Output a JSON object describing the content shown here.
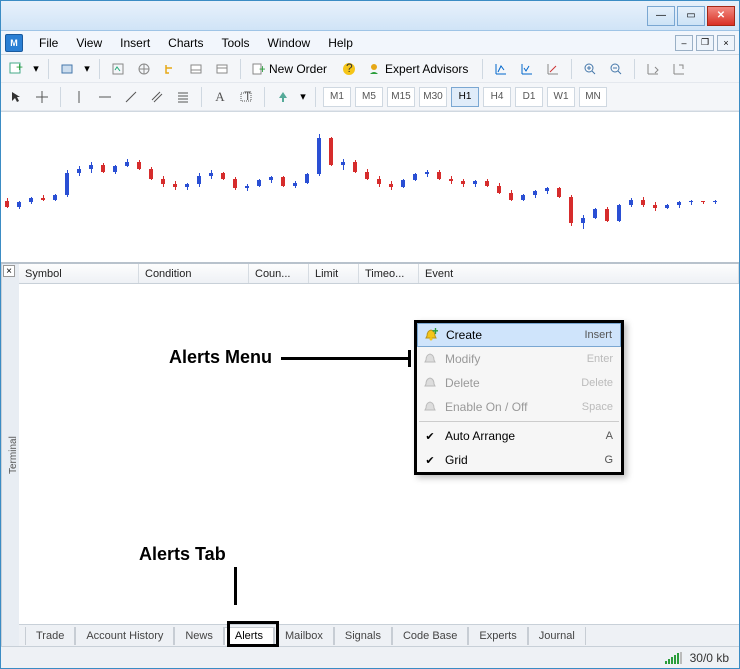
{
  "window": {
    "title": ""
  },
  "menubar": {
    "items": [
      "File",
      "View",
      "Insert",
      "Charts",
      "Tools",
      "Window",
      "Help"
    ]
  },
  "toolbar1": {
    "new_order": "New Order",
    "expert_advisors": "Expert Advisors"
  },
  "timeframes": [
    "M1",
    "M5",
    "M15",
    "M30",
    "H1",
    "H4",
    "D1",
    "W1",
    "MN"
  ],
  "active_timeframe": "H1",
  "terminal": {
    "label": "Terminal",
    "columns": {
      "symbol": "Symbol",
      "condition": "Condition",
      "counter": "Coun...",
      "limit": "Limit",
      "timeout": "Timeo...",
      "event": "Event"
    }
  },
  "context_menu": {
    "create": {
      "label": "Create",
      "shortcut": "Insert"
    },
    "modify": {
      "label": "Modify",
      "shortcut": "Enter"
    },
    "delete": {
      "label": "Delete",
      "shortcut": "Delete"
    },
    "enable": {
      "label": "Enable On / Off",
      "shortcut": "Space"
    },
    "auto_arrange": {
      "label": "Auto Arrange",
      "shortcut": "A"
    },
    "grid": {
      "label": "Grid",
      "shortcut": "G"
    }
  },
  "tabs": [
    "Trade",
    "Account History",
    "News",
    "Alerts",
    "Mailbox",
    "Signals",
    "Code Base",
    "Experts",
    "Journal"
  ],
  "active_tab": "Alerts",
  "status": {
    "traffic": "30/0 kb"
  },
  "annotations": {
    "menu_label": "Alerts Menu",
    "tab_label": "Alerts Tab"
  },
  "chart_data": {
    "type": "candlestick",
    "note": "Forex candlestick chart, approximate OHLC inferred from relative heights (arbitrary units 0-100, higher = higher price)",
    "series": [
      {
        "o": 40,
        "h": 42,
        "l": 35,
        "c": 36,
        "color": "red"
      },
      {
        "o": 36,
        "h": 40,
        "l": 34,
        "c": 39,
        "color": "blue"
      },
      {
        "o": 39,
        "h": 43,
        "l": 38,
        "c": 42,
        "color": "blue"
      },
      {
        "o": 42,
        "h": 44,
        "l": 40,
        "c": 41,
        "color": "red"
      },
      {
        "o": 41,
        "h": 45,
        "l": 40,
        "c": 44,
        "color": "blue"
      },
      {
        "o": 44,
        "h": 62,
        "l": 43,
        "c": 60,
        "color": "blue"
      },
      {
        "o": 60,
        "h": 65,
        "l": 58,
        "c": 63,
        "color": "blue"
      },
      {
        "o": 63,
        "h": 68,
        "l": 60,
        "c": 66,
        "color": "blue"
      },
      {
        "o": 66,
        "h": 67,
        "l": 60,
        "c": 61,
        "color": "red"
      },
      {
        "o": 61,
        "h": 66,
        "l": 59,
        "c": 65,
        "color": "blue"
      },
      {
        "o": 65,
        "h": 70,
        "l": 64,
        "c": 68,
        "color": "blue"
      },
      {
        "o": 68,
        "h": 69,
        "l": 62,
        "c": 63,
        "color": "red"
      },
      {
        "o": 63,
        "h": 64,
        "l": 55,
        "c": 56,
        "color": "red"
      },
      {
        "o": 56,
        "h": 58,
        "l": 50,
        "c": 52,
        "color": "red"
      },
      {
        "o": 52,
        "h": 54,
        "l": 48,
        "c": 50,
        "color": "red"
      },
      {
        "o": 50,
        "h": 53,
        "l": 48,
        "c": 52,
        "color": "blue"
      },
      {
        "o": 52,
        "h": 60,
        "l": 50,
        "c": 58,
        "color": "blue"
      },
      {
        "o": 58,
        "h": 62,
        "l": 56,
        "c": 60,
        "color": "blue"
      },
      {
        "o": 60,
        "h": 61,
        "l": 55,
        "c": 56,
        "color": "red"
      },
      {
        "o": 56,
        "h": 57,
        "l": 48,
        "c": 49,
        "color": "red"
      },
      {
        "o": 49,
        "h": 52,
        "l": 47,
        "c": 51,
        "color": "blue"
      },
      {
        "o": 51,
        "h": 56,
        "l": 50,
        "c": 55,
        "color": "blue"
      },
      {
        "o": 55,
        "h": 58,
        "l": 53,
        "c": 57,
        "color": "blue"
      },
      {
        "o": 57,
        "h": 58,
        "l": 50,
        "c": 51,
        "color": "red"
      },
      {
        "o": 51,
        "h": 54,
        "l": 49,
        "c": 53,
        "color": "blue"
      },
      {
        "o": 53,
        "h": 60,
        "l": 52,
        "c": 59,
        "color": "blue"
      },
      {
        "o": 59,
        "h": 88,
        "l": 58,
        "c": 85,
        "color": "blue"
      },
      {
        "o": 85,
        "h": 86,
        "l": 65,
        "c": 66,
        "color": "red"
      },
      {
        "o": 66,
        "h": 70,
        "l": 62,
        "c": 68,
        "color": "blue"
      },
      {
        "o": 68,
        "h": 69,
        "l": 60,
        "c": 61,
        "color": "red"
      },
      {
        "o": 61,
        "h": 63,
        "l": 55,
        "c": 56,
        "color": "red"
      },
      {
        "o": 56,
        "h": 58,
        "l": 50,
        "c": 52,
        "color": "red"
      },
      {
        "o": 52,
        "h": 54,
        "l": 48,
        "c": 50,
        "color": "red"
      },
      {
        "o": 50,
        "h": 56,
        "l": 49,
        "c": 55,
        "color": "blue"
      },
      {
        "o": 55,
        "h": 60,
        "l": 54,
        "c": 59,
        "color": "blue"
      },
      {
        "o": 59,
        "h": 62,
        "l": 57,
        "c": 61,
        "color": "blue"
      },
      {
        "o": 61,
        "h": 62,
        "l": 55,
        "c": 56,
        "color": "red"
      },
      {
        "o": 56,
        "h": 58,
        "l": 52,
        "c": 54,
        "color": "red"
      },
      {
        "o": 54,
        "h": 56,
        "l": 50,
        "c": 52,
        "color": "red"
      },
      {
        "o": 52,
        "h": 55,
        "l": 50,
        "c": 54,
        "color": "blue"
      },
      {
        "o": 54,
        "h": 56,
        "l": 50,
        "c": 51,
        "color": "red"
      },
      {
        "o": 51,
        "h": 53,
        "l": 45,
        "c": 46,
        "color": "red"
      },
      {
        "o": 46,
        "h": 48,
        "l": 40,
        "c": 41,
        "color": "red"
      },
      {
        "o": 41,
        "h": 45,
        "l": 40,
        "c": 44,
        "color": "blue"
      },
      {
        "o": 44,
        "h": 48,
        "l": 42,
        "c": 47,
        "color": "blue"
      },
      {
        "o": 47,
        "h": 50,
        "l": 45,
        "c": 49,
        "color": "blue"
      },
      {
        "o": 49,
        "h": 50,
        "l": 42,
        "c": 43,
        "color": "red"
      },
      {
        "o": 43,
        "h": 44,
        "l": 22,
        "c": 24,
        "color": "red"
      },
      {
        "o": 24,
        "h": 30,
        "l": 20,
        "c": 28,
        "color": "blue"
      },
      {
        "o": 28,
        "h": 35,
        "l": 27,
        "c": 34,
        "color": "blue"
      },
      {
        "o": 34,
        "h": 36,
        "l": 25,
        "c": 26,
        "color": "red"
      },
      {
        "o": 26,
        "h": 38,
        "l": 25,
        "c": 37,
        "color": "blue"
      },
      {
        "o": 37,
        "h": 42,
        "l": 36,
        "c": 41,
        "color": "blue"
      },
      {
        "o": 41,
        "h": 43,
        "l": 36,
        "c": 37,
        "color": "red"
      },
      {
        "o": 37,
        "h": 39,
        "l": 33,
        "c": 35,
        "color": "red"
      },
      {
        "o": 35,
        "h": 38,
        "l": 34,
        "c": 37,
        "color": "blue"
      },
      {
        "o": 37,
        "h": 40,
        "l": 35,
        "c": 39,
        "color": "blue"
      },
      {
        "o": 39,
        "h": 41,
        "l": 37,
        "c": 40,
        "color": "blue"
      },
      {
        "o": 40,
        "h": 40,
        "l": 38,
        "c": 39,
        "color": "red"
      },
      {
        "o": 39,
        "h": 41,
        "l": 38,
        "c": 40,
        "color": "blue"
      }
    ]
  }
}
